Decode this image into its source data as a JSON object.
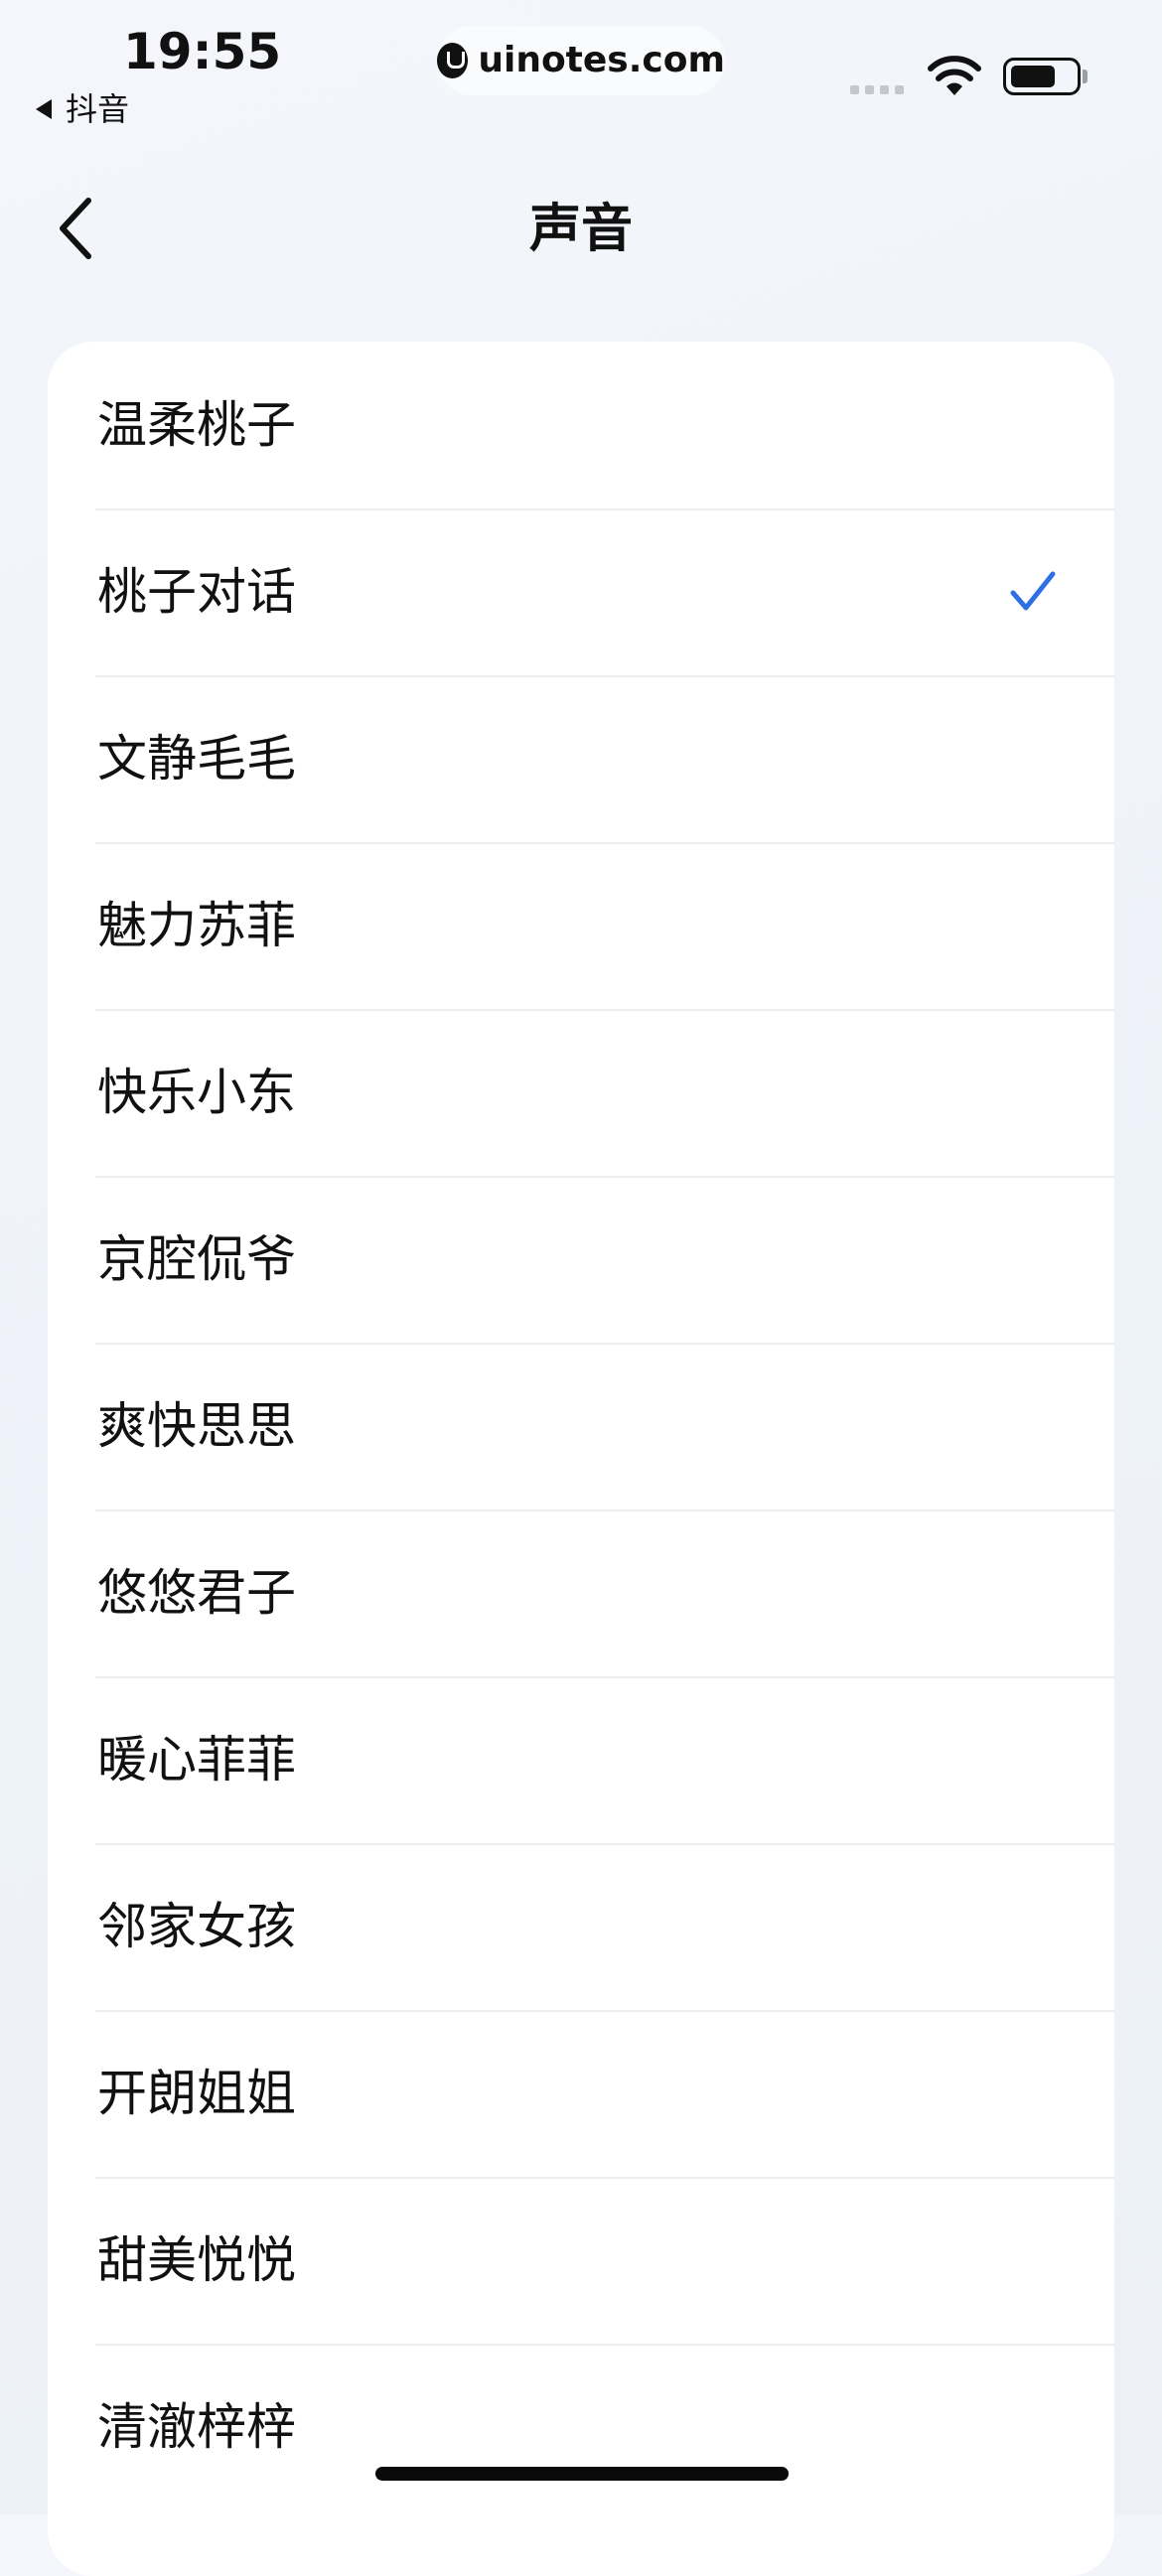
{
  "status_bar": {
    "time": "19:55",
    "back_app": "抖音",
    "url": "uinotes.com"
  },
  "header": {
    "title": "声音"
  },
  "voices": [
    {
      "label": "温柔桃子",
      "selected": false
    },
    {
      "label": "桃子对话",
      "selected": true
    },
    {
      "label": "文静毛毛",
      "selected": false
    },
    {
      "label": "魅力苏菲",
      "selected": false
    },
    {
      "label": "快乐小东",
      "selected": false
    },
    {
      "label": "京腔侃爷",
      "selected": false
    },
    {
      "label": "爽快思思",
      "selected": false
    },
    {
      "label": "悠悠君子",
      "selected": false
    },
    {
      "label": "暖心菲菲",
      "selected": false
    },
    {
      "label": "邻家女孩",
      "selected": false
    },
    {
      "label": "开朗姐姐",
      "selected": false
    },
    {
      "label": "甜美悦悦",
      "selected": false
    },
    {
      "label": "清澈梓梓",
      "selected": false
    }
  ],
  "colors": {
    "accent": "#2f6fe4",
    "background": "#eef2f9",
    "card": "#ffffff",
    "divider": "#ebedf0"
  },
  "icons": {
    "back": "chevron-left-icon",
    "selected": "checkmark-icon",
    "wifi": "wifi-icon",
    "battery": "battery-icon",
    "signal": "cellular-signal-icon"
  }
}
